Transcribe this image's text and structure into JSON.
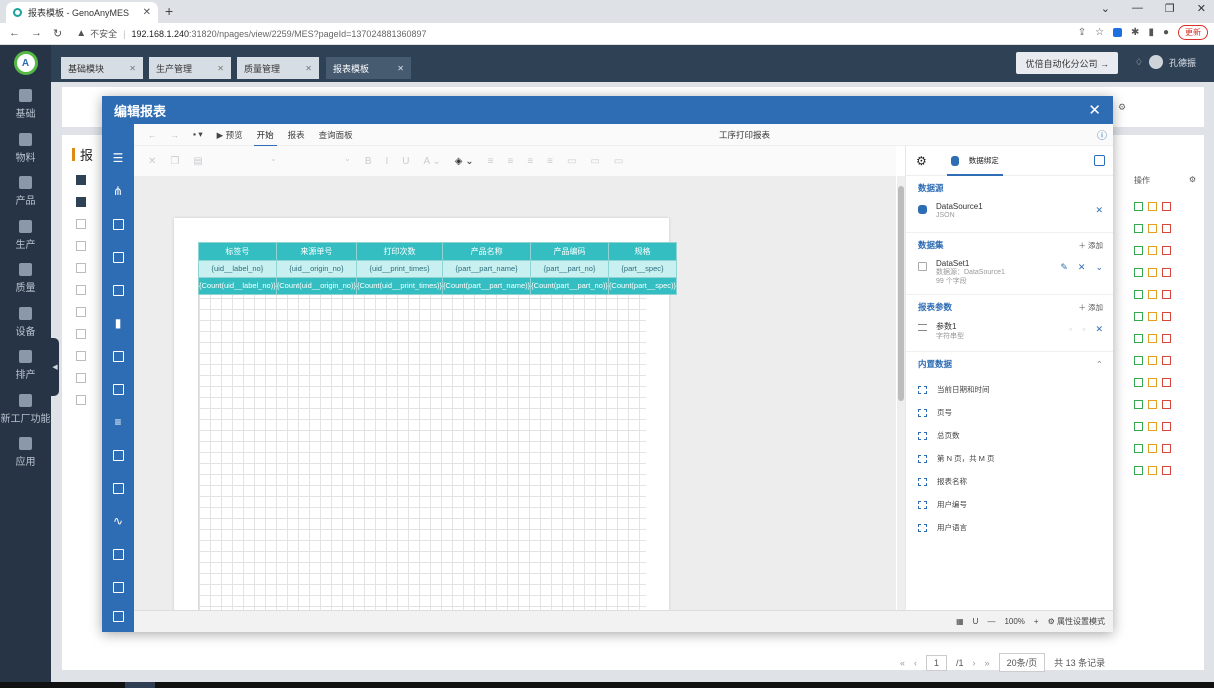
{
  "browser": {
    "tab_title": "报表模板 - GenoAnyMES",
    "insecure_label": "不安全",
    "url_host": "192.168.1.240",
    "url_path": ":31820/npages/view/2259/MES?pageId=1370248813608​97",
    "update_label": "更新"
  },
  "app": {
    "sidebar": [
      {
        "label": "基础"
      },
      {
        "label": "物料"
      },
      {
        "label": "产品"
      },
      {
        "label": "生产"
      },
      {
        "label": "质量"
      },
      {
        "label": "设备"
      },
      {
        "label": "排产"
      },
      {
        "label": "新工厂功能"
      },
      {
        "label": "应用"
      }
    ],
    "tabs": [
      {
        "label": "基础模块"
      },
      {
        "label": "生产管理"
      },
      {
        "label": "质量管理"
      },
      {
        "label": "报表模板"
      }
    ],
    "company": "优倍自动化分公司 →",
    "user": "孔德振"
  },
  "background": {
    "title": "报",
    "ops_label": "操作",
    "pager_page": "1",
    "pager_total_pages": "/1",
    "page_size": "20条/页",
    "total": "共 13 条记录"
  },
  "dialog": {
    "title": "编辑报表",
    "menu": {
      "preview": "预览",
      "start": "开始",
      "report": "报表",
      "query_panel": "查询面板",
      "doc_title": "工序打印报表"
    },
    "table": {
      "headers": [
        "标签号",
        "来源单号",
        "打印次数",
        "产品名称",
        "产品编码",
        "规格"
      ],
      "fields": [
        "{uid__label_no}",
        "{uid__origin_no}",
        "{uid__print_times}",
        "{part__part_name}",
        "{part__part_no}",
        "{part__spec}"
      ],
      "counts": [
        "{Count(uid__label_no)}",
        "{Count(uid__origin_no)}",
        "{Count(uid__print_times)}",
        "{Count(part__part_name)}",
        "{Count(part__part_no)}",
        "{Count(part__spec)}"
      ]
    },
    "right_panel": {
      "tab_label": "数据绑定",
      "datasource": {
        "title": "数据源",
        "name": "DataSource1",
        "type": "JSON"
      },
      "dataset": {
        "title": "数据集",
        "add": "添加",
        "name": "DataSet1",
        "source": "数据源：DataSource1",
        "fields": "99 个字段"
      },
      "params": {
        "title": "报表参数",
        "add": "添加",
        "name": "参数1",
        "type": "字符串型"
      },
      "builtin": {
        "title": "内置数据",
        "items": [
          "当前日期和时间",
          "页号",
          "总页数",
          "第 N 页，共 M 页",
          "报表名称",
          "用户编号",
          "用户语言"
        ]
      }
    },
    "status": {
      "zoom": "100%",
      "mode": "属性设置模式"
    }
  }
}
